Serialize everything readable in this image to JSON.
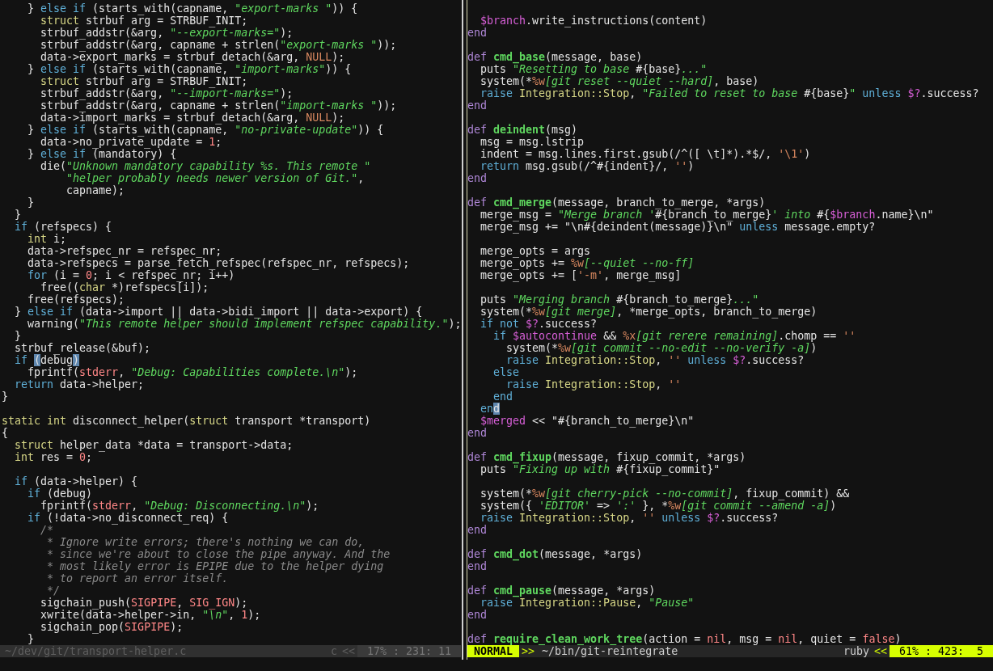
{
  "panes": [
    {
      "lines": [
        {
          "kind": "code",
          "spans": [
            {
              "kind": "n",
              "text": "    } "
            },
            {
              "kind": "k",
              "text": "else if"
            },
            {
              "kind": "n",
              "text": " (starts_with(capname, "
            },
            {
              "kind": "s",
              "text": "\"export-marks \""
            },
            {
              "kind": "n",
              "text": ")) {"
            }
          ]
        },
        {
          "kind": "code",
          "spans": [
            {
              "kind": "t",
              "text": "      struct"
            },
            {
              "kind": "n",
              "text": " strbuf arg = STRBUF_INIT;"
            }
          ]
        },
        {
          "kind": "code",
          "spans": [
            {
              "kind": "n",
              "text": "      strbuf_addstr(&arg, "
            },
            {
              "kind": "s",
              "text": "\"--export-marks=\""
            },
            {
              "kind": "n",
              "text": ");"
            }
          ]
        },
        {
          "kind": "code",
          "spans": [
            {
              "kind": "n",
              "text": "      strbuf_addstr(&arg, capname + strlen("
            },
            {
              "kind": "s",
              "text": "\"export-marks \""
            },
            {
              "kind": "n",
              "text": "));"
            }
          ]
        },
        {
          "kind": "code",
          "spans": [
            {
              "kind": "n",
              "text": "      data->export_marks = strbuf_detach(&arg, "
            },
            {
              "kind": "o",
              "text": "NULL"
            },
            {
              "kind": "n",
              "text": ");"
            }
          ]
        },
        {
          "kind": "code",
          "spans": [
            {
              "kind": "n",
              "text": "    } "
            },
            {
              "kind": "k",
              "text": "else if"
            },
            {
              "kind": "n",
              "text": " (starts_with(capname, "
            },
            {
              "kind": "s",
              "text": "\"import-marks\""
            },
            {
              "kind": "n",
              "text": ")) {"
            }
          ]
        },
        {
          "kind": "code",
          "spans": [
            {
              "kind": "t",
              "text": "      struct"
            },
            {
              "kind": "n",
              "text": " strbuf arg = STRBUF_INIT;"
            }
          ]
        },
        {
          "kind": "code",
          "spans": [
            {
              "kind": "n",
              "text": "      strbuf_addstr(&arg, "
            },
            {
              "kind": "s",
              "text": "\"--import-marks=\""
            },
            {
              "kind": "n",
              "text": ");"
            }
          ]
        },
        {
          "kind": "code",
          "spans": [
            {
              "kind": "n",
              "text": "      strbuf_addstr(&arg, capname + strlen("
            },
            {
              "kind": "s",
              "text": "\"import-marks \""
            },
            {
              "kind": "n",
              "text": "));"
            }
          ]
        },
        {
          "kind": "code",
          "spans": [
            {
              "kind": "n",
              "text": "      data->import_marks = strbuf_detach(&arg, "
            },
            {
              "kind": "o",
              "text": "NULL"
            },
            {
              "kind": "n",
              "text": ");"
            }
          ]
        },
        {
          "kind": "code",
          "spans": [
            {
              "kind": "n",
              "text": "    } "
            },
            {
              "kind": "k",
              "text": "else if"
            },
            {
              "kind": "n",
              "text": " (starts_with(capname, "
            },
            {
              "kind": "s",
              "text": "\"no-private-update\""
            },
            {
              "kind": "n",
              "text": ")) {"
            }
          ]
        },
        {
          "kind": "code",
          "spans": [
            {
              "kind": "n",
              "text": "      data->no_private_update = "
            },
            {
              "kind": "c",
              "text": "1"
            },
            {
              "kind": "n",
              "text": ";"
            }
          ]
        },
        {
          "kind": "code",
          "spans": [
            {
              "kind": "n",
              "text": "    } "
            },
            {
              "kind": "k",
              "text": "else if"
            },
            {
              "kind": "n",
              "text": " (mandatory) {"
            }
          ]
        },
        {
          "kind": "code",
          "spans": [
            {
              "kind": "n",
              "text": "      die("
            },
            {
              "kind": "s",
              "text": "\"Unknown mandatory capability %s. This remote \""
            }
          ]
        },
        {
          "kind": "code",
          "spans": [
            {
              "kind": "s",
              "text": "          \"helper probably needs newer version of Git.\""
            },
            {
              "kind": "n",
              "text": ","
            }
          ]
        },
        {
          "kind": "code",
          "spans": [
            {
              "kind": "n",
              "text": "          capname);"
            }
          ]
        },
        {
          "kind": "code",
          "spans": [
            {
              "kind": "n",
              "text": "    }"
            }
          ]
        },
        {
          "kind": "code",
          "spans": [
            {
              "kind": "n",
              "text": "  }"
            }
          ]
        },
        {
          "kind": "code",
          "spans": [
            {
              "kind": "k",
              "text": "  if"
            },
            {
              "kind": "n",
              "text": " (refspecs) {"
            }
          ]
        },
        {
          "kind": "code",
          "spans": [
            {
              "kind": "t",
              "text": "    int"
            },
            {
              "kind": "n",
              "text": " i;"
            }
          ]
        },
        {
          "kind": "code",
          "spans": [
            {
              "kind": "n",
              "text": "    data->refspec_nr = refspec_nr;"
            }
          ]
        },
        {
          "kind": "code",
          "spans": [
            {
              "kind": "n",
              "text": "    data->refspecs = parse_fetch_refspec(refspec_nr, refspecs);"
            }
          ]
        },
        {
          "kind": "code",
          "spans": [
            {
              "kind": "k",
              "text": "    for"
            },
            {
              "kind": "n",
              "text": " (i = "
            },
            {
              "kind": "c",
              "text": "0"
            },
            {
              "kind": "n",
              "text": "; i < refspec_nr; i++)"
            }
          ]
        },
        {
          "kind": "code",
          "spans": [
            {
              "kind": "n",
              "text": "      free(("
            },
            {
              "kind": "t",
              "text": "char"
            },
            {
              "kind": "n",
              "text": " *)refspecs[i]);"
            }
          ]
        },
        {
          "kind": "code",
          "spans": [
            {
              "kind": "n",
              "text": "    free(refspecs);"
            }
          ]
        },
        {
          "kind": "code",
          "spans": [
            {
              "kind": "n",
              "text": "  } "
            },
            {
              "kind": "k",
              "text": "else if"
            },
            {
              "kind": "n",
              "text": " (data->import || data->bidi_import || data->export) {"
            }
          ]
        },
        {
          "kind": "code",
          "spans": [
            {
              "kind": "n",
              "text": "    warning("
            },
            {
              "kind": "s",
              "text": "\"This remote helper should implement refspec capability.\""
            },
            {
              "kind": "n",
              "text": ");"
            }
          ]
        },
        {
          "kind": "code",
          "spans": [
            {
              "kind": "n",
              "text": "  }"
            }
          ]
        },
        {
          "kind": "code",
          "spans": [
            {
              "kind": "n",
              "text": "  strbuf_release(&buf);"
            }
          ]
        },
        {
          "kind": "code",
          "spans": [
            {
              "kind": "k",
              "text": "  if "
            },
            {
              "kind": "h",
              "text": "("
            },
            {
              "kind": "n",
              "text": "debug"
            },
            {
              "kind": "h",
              "text": ")"
            }
          ]
        },
        {
          "kind": "code",
          "spans": [
            {
              "kind": "n",
              "text": "    fprintf("
            },
            {
              "kind": "c",
              "text": "stderr"
            },
            {
              "kind": "n",
              "text": ", "
            },
            {
              "kind": "s",
              "text": "\"Debug: Capabilities complete.\\n\""
            },
            {
              "kind": "n",
              "text": ");"
            }
          ]
        },
        {
          "kind": "code",
          "spans": [
            {
              "kind": "k",
              "text": "  return"
            },
            {
              "kind": "n",
              "text": " data->helper;"
            }
          ]
        },
        {
          "kind": "code",
          "spans": [
            {
              "kind": "n",
              "text": "}"
            }
          ]
        },
        {
          "kind": "blank"
        },
        {
          "kind": "code",
          "spans": [
            {
              "kind": "t",
              "text": "static int"
            },
            {
              "kind": "n",
              "text": " disconnect_helper("
            },
            {
              "kind": "t",
              "text": "struct"
            },
            {
              "kind": "n",
              "text": " transport *transport)"
            }
          ]
        },
        {
          "kind": "code",
          "spans": [
            {
              "kind": "n",
              "text": "{"
            }
          ]
        },
        {
          "kind": "code",
          "spans": [
            {
              "kind": "t",
              "text": "  struct"
            },
            {
              "kind": "n",
              "text": " helper_data *data = transport->data;"
            }
          ]
        },
        {
          "kind": "code",
          "spans": [
            {
              "kind": "t",
              "text": "  int"
            },
            {
              "kind": "n",
              "text": " res = "
            },
            {
              "kind": "c",
              "text": "0"
            },
            {
              "kind": "n",
              "text": ";"
            }
          ]
        },
        {
          "kind": "blank"
        },
        {
          "kind": "code",
          "spans": [
            {
              "kind": "k",
              "text": "  if"
            },
            {
              "kind": "n",
              "text": " (data->helper) {"
            }
          ]
        },
        {
          "kind": "code",
          "spans": [
            {
              "kind": "k",
              "text": "    if"
            },
            {
              "kind": "n",
              "text": " (debug)"
            }
          ]
        },
        {
          "kind": "code",
          "spans": [
            {
              "kind": "n",
              "text": "      fprintf("
            },
            {
              "kind": "c",
              "text": "stderr"
            },
            {
              "kind": "n",
              "text": ", "
            },
            {
              "kind": "s",
              "text": "\"Debug: Disconnecting.\\n\""
            },
            {
              "kind": "n",
              "text": ");"
            }
          ]
        },
        {
          "kind": "code",
          "spans": [
            {
              "kind": "k",
              "text": "    if"
            },
            {
              "kind": "n",
              "text": " (!data->no_disconnect_req) {"
            }
          ]
        },
        {
          "kind": "code",
          "spans": [
            {
              "kind": "m",
              "text": "      /*"
            }
          ]
        },
        {
          "kind": "code",
          "spans": [
            {
              "kind": "m",
              "text": "       * Ignore write errors; there's nothing we can do,"
            }
          ]
        },
        {
          "kind": "code",
          "spans": [
            {
              "kind": "m",
              "text": "       * since we're about to close the pipe anyway. And the"
            }
          ]
        },
        {
          "kind": "code",
          "spans": [
            {
              "kind": "m",
              "text": "       * most likely error is EPIPE due to the helper dying"
            }
          ]
        },
        {
          "kind": "code",
          "spans": [
            {
              "kind": "m",
              "text": "       * to report an error itself."
            }
          ]
        },
        {
          "kind": "code",
          "spans": [
            {
              "kind": "m",
              "text": "       */"
            }
          ]
        },
        {
          "kind": "code",
          "spans": [
            {
              "kind": "n",
              "text": "      sigchain_push("
            },
            {
              "kind": "c",
              "text": "SIGPIPE"
            },
            {
              "kind": "n",
              "text": ", "
            },
            {
              "kind": "c",
              "text": "SIG_IGN"
            },
            {
              "kind": "n",
              "text": ");"
            }
          ]
        },
        {
          "kind": "code",
          "spans": [
            {
              "kind": "n",
              "text": "      xwrite(data->helper->in, "
            },
            {
              "kind": "s",
              "text": "\"\\n\""
            },
            {
              "kind": "n",
              "text": ", "
            },
            {
              "kind": "c",
              "text": "1"
            },
            {
              "kind": "n",
              "text": ");"
            }
          ]
        },
        {
          "kind": "code",
          "spans": [
            {
              "kind": "n",
              "text": "      sigchain_pop("
            },
            {
              "kind": "c",
              "text": "SIGPIPE"
            },
            {
              "kind": "n",
              "text": ");"
            }
          ]
        },
        {
          "kind": "code",
          "spans": [
            {
              "kind": "n",
              "text": "    }"
            }
          ]
        }
      ],
      "status": {
        "active": false,
        "path": "~/dev/git/transport-helper.c",
        "filetype": "c",
        "arrow": "<<",
        "position": "17% : 231: 11"
      }
    },
    {
      "lines": [
        {
          "kind": "blank"
        },
        {
          "kind": "code",
          "spans": [
            {
              "kind": "g",
              "text": "  $branch"
            },
            {
              "kind": "n",
              "text": ".write_instructions(content)"
            }
          ]
        },
        {
          "kind": "code",
          "spans": [
            {
              "kind": "d",
              "text": "end"
            }
          ]
        },
        {
          "kind": "blank"
        },
        {
          "kind": "code",
          "spans": [
            {
              "kind": "d",
              "text": "def "
            },
            {
              "kind": "f",
              "text": "cmd_base"
            },
            {
              "kind": "n",
              "text": "(message, base)"
            }
          ]
        },
        {
          "kind": "code",
          "spans": [
            {
              "kind": "n",
              "text": "  puts "
            },
            {
              "kind": "s",
              "text": "\"Resetting to base "
            },
            {
              "kind": "n",
              "text": "#{base}"
            },
            {
              "kind": "s",
              "text": "...\""
            }
          ]
        },
        {
          "kind": "code",
          "spans": [
            {
              "kind": "n",
              "text": "  system(*"
            },
            {
              "kind": "o",
              "text": "%w"
            },
            {
              "kind": "s",
              "text": "[git reset --quiet --hard]"
            },
            {
              "kind": "n",
              "text": ", base)"
            }
          ]
        },
        {
          "kind": "code",
          "spans": [
            {
              "kind": "k",
              "text": "  raise "
            },
            {
              "kind": "t",
              "text": "Integration::Stop"
            },
            {
              "kind": "n",
              "text": ", "
            },
            {
              "kind": "s",
              "text": "\"Failed to reset to base "
            },
            {
              "kind": "n",
              "text": "#{base}"
            },
            {
              "kind": "s",
              "text": "\" "
            },
            {
              "kind": "k",
              "text": "unless "
            },
            {
              "kind": "g",
              "text": "$?"
            },
            {
              "kind": "n",
              "text": ".success?"
            }
          ]
        },
        {
          "kind": "code",
          "spans": [
            {
              "kind": "d",
              "text": "end"
            }
          ]
        },
        {
          "kind": "blank"
        },
        {
          "kind": "code",
          "spans": [
            {
              "kind": "d",
              "text": "def "
            },
            {
              "kind": "f",
              "text": "deindent"
            },
            {
              "kind": "n",
              "text": "(msg)"
            }
          ]
        },
        {
          "kind": "code",
          "spans": [
            {
              "kind": "n",
              "text": "  msg = msg.lstrip"
            }
          ]
        },
        {
          "kind": "code",
          "spans": [
            {
              "kind": "n",
              "text": "  indent = msg.lines.first.gsub(/^([ \\t]*).*$/, "
            },
            {
              "kind": "o",
              "text": "'\\1'"
            },
            {
              "kind": "n",
              "text": ")"
            }
          ]
        },
        {
          "kind": "code",
          "spans": [
            {
              "kind": "k",
              "text": "  return"
            },
            {
              "kind": "n",
              "text": " msg.gsub(/^#{indent}/, "
            },
            {
              "kind": "o",
              "text": "''"
            },
            {
              "kind": "n",
              "text": ")"
            }
          ]
        },
        {
          "kind": "code",
          "spans": [
            {
              "kind": "d",
              "text": "end"
            }
          ]
        },
        {
          "kind": "blank"
        },
        {
          "kind": "code",
          "spans": [
            {
              "kind": "d",
              "text": "def "
            },
            {
              "kind": "f",
              "text": "cmd_merge"
            },
            {
              "kind": "n",
              "text": "(message, branch_to_merge, *args)"
            }
          ]
        },
        {
          "kind": "code",
          "spans": [
            {
              "kind": "n",
              "text": "  merge_msg = "
            },
            {
              "kind": "s",
              "text": "\"Merge branch '"
            },
            {
              "kind": "n",
              "text": "#{branch_to_merge}"
            },
            {
              "kind": "s",
              "text": "' into "
            },
            {
              "kind": "n",
              "text": "#{"
            },
            {
              "kind": "g",
              "text": "$branch"
            },
            {
              "kind": "n",
              "text": ".name}\\n\""
            }
          ]
        },
        {
          "kind": "code",
          "spans": [
            {
              "kind": "n",
              "text": "  merge_msg += \"\\n#{deindent(message)}\\n\" "
            },
            {
              "kind": "k",
              "text": "unless"
            },
            {
              "kind": "n",
              "text": " message.empty?"
            }
          ]
        },
        {
          "kind": "blank"
        },
        {
          "kind": "code",
          "spans": [
            {
              "kind": "n",
              "text": "  merge_opts = args"
            }
          ]
        },
        {
          "kind": "code",
          "spans": [
            {
              "kind": "n",
              "text": "  merge_opts += "
            },
            {
              "kind": "o",
              "text": "%w"
            },
            {
              "kind": "s",
              "text": "[--quiet --no-ff]"
            }
          ]
        },
        {
          "kind": "code",
          "spans": [
            {
              "kind": "n",
              "text": "  merge_opts += ["
            },
            {
              "kind": "o",
              "text": "'-m'"
            },
            {
              "kind": "n",
              "text": ", merge_msg]"
            }
          ]
        },
        {
          "kind": "blank"
        },
        {
          "kind": "code",
          "spans": [
            {
              "kind": "n",
              "text": "  puts "
            },
            {
              "kind": "s",
              "text": "\"Merging branch "
            },
            {
              "kind": "n",
              "text": "#{branch_to_merge}"
            },
            {
              "kind": "s",
              "text": "...\""
            }
          ]
        },
        {
          "kind": "code",
          "spans": [
            {
              "kind": "n",
              "text": "  system(*"
            },
            {
              "kind": "o",
              "text": "%w"
            },
            {
              "kind": "s",
              "text": "[git merge]"
            },
            {
              "kind": "n",
              "text": ", *merge_opts, branch_to_merge)"
            }
          ]
        },
        {
          "kind": "code",
          "spans": [
            {
              "kind": "k",
              "text": "  if not "
            },
            {
              "kind": "g",
              "text": "$?"
            },
            {
              "kind": "n",
              "text": ".success?"
            }
          ]
        },
        {
          "kind": "code",
          "spans": [
            {
              "kind": "k",
              "text": "    if "
            },
            {
              "kind": "g",
              "text": "$autocontinue"
            },
            {
              "kind": "n",
              "text": " && "
            },
            {
              "kind": "o",
              "text": "%x"
            },
            {
              "kind": "s",
              "text": "[git rerere remaining]"
            },
            {
              "kind": "n",
              "text": ".chomp == "
            },
            {
              "kind": "o",
              "text": "''"
            }
          ]
        },
        {
          "kind": "code",
          "spans": [
            {
              "kind": "n",
              "text": "      system(*"
            },
            {
              "kind": "o",
              "text": "%w"
            },
            {
              "kind": "s",
              "text": "[git commit --no-edit --no-verify -a]"
            },
            {
              "kind": "n",
              "text": ")"
            }
          ]
        },
        {
          "kind": "code",
          "spans": [
            {
              "kind": "k",
              "text": "      raise "
            },
            {
              "kind": "t",
              "text": "Integration::Stop"
            },
            {
              "kind": "n",
              "text": ", "
            },
            {
              "kind": "o",
              "text": "'' "
            },
            {
              "kind": "k",
              "text": "unless "
            },
            {
              "kind": "g",
              "text": "$?"
            },
            {
              "kind": "n",
              "text": ".success?"
            }
          ]
        },
        {
          "kind": "code",
          "spans": [
            {
              "kind": "k",
              "text": "    else"
            }
          ]
        },
        {
          "kind": "code",
          "spans": [
            {
              "kind": "k",
              "text": "      raise "
            },
            {
              "kind": "t",
              "text": "Integration::Stop"
            },
            {
              "kind": "n",
              "text": ", "
            },
            {
              "kind": "o",
              "text": "''"
            }
          ]
        },
        {
          "kind": "code",
          "spans": [
            {
              "kind": "k",
              "text": "    end"
            }
          ]
        },
        {
          "kind": "code",
          "spans": [
            {
              "kind": "k",
              "text": "  en"
            },
            {
              "kind": "h",
              "text": "d"
            }
          ]
        },
        {
          "kind": "code",
          "spans": [
            {
              "kind": "g",
              "text": "  $merged"
            },
            {
              "kind": "n",
              "text": " << \"#{branch_to_merge}\\n\""
            }
          ]
        },
        {
          "kind": "code",
          "spans": [
            {
              "kind": "d",
              "text": "end"
            }
          ]
        },
        {
          "kind": "blank"
        },
        {
          "kind": "code",
          "spans": [
            {
              "kind": "d",
              "text": "def "
            },
            {
              "kind": "f",
              "text": "cmd_fixup"
            },
            {
              "kind": "n",
              "text": "(message, fixup_commit, *args)"
            }
          ]
        },
        {
          "kind": "code",
          "spans": [
            {
              "kind": "n",
              "text": "  puts "
            },
            {
              "kind": "s",
              "text": "\"Fixing up with "
            },
            {
              "kind": "n",
              "text": "#{fixup_commit}\""
            }
          ]
        },
        {
          "kind": "blank"
        },
        {
          "kind": "code",
          "spans": [
            {
              "kind": "n",
              "text": "  system(*"
            },
            {
              "kind": "o",
              "text": "%w"
            },
            {
              "kind": "s",
              "text": "[git cherry-pick --no-commit]"
            },
            {
              "kind": "n",
              "text": ", fixup_commit) &&"
            }
          ]
        },
        {
          "kind": "code",
          "spans": [
            {
              "kind": "n",
              "text": "  system({ "
            },
            {
              "kind": "s",
              "text": "'EDITOR'"
            },
            {
              "kind": "n",
              "text": " => "
            },
            {
              "kind": "s",
              "text": "':'"
            },
            {
              "kind": "n",
              "text": " }, *"
            },
            {
              "kind": "o",
              "text": "%w"
            },
            {
              "kind": "s",
              "text": "[git commit --amend -a]"
            },
            {
              "kind": "n",
              "text": ")"
            }
          ]
        },
        {
          "kind": "code",
          "spans": [
            {
              "kind": "k",
              "text": "  raise "
            },
            {
              "kind": "t",
              "text": "Integration::Stop"
            },
            {
              "kind": "n",
              "text": ", "
            },
            {
              "kind": "o",
              "text": "'' "
            },
            {
              "kind": "k",
              "text": "unless "
            },
            {
              "kind": "g",
              "text": "$?"
            },
            {
              "kind": "n",
              "text": ".success?"
            }
          ]
        },
        {
          "kind": "code",
          "spans": [
            {
              "kind": "d",
              "text": "end"
            }
          ]
        },
        {
          "kind": "blank"
        },
        {
          "kind": "code",
          "spans": [
            {
              "kind": "d",
              "text": "def "
            },
            {
              "kind": "f",
              "text": "cmd_dot"
            },
            {
              "kind": "n",
              "text": "(message, *args)"
            }
          ]
        },
        {
          "kind": "code",
          "spans": [
            {
              "kind": "d",
              "text": "end"
            }
          ]
        },
        {
          "kind": "blank"
        },
        {
          "kind": "code",
          "spans": [
            {
              "kind": "d",
              "text": "def "
            },
            {
              "kind": "f",
              "text": "cmd_pause"
            },
            {
              "kind": "n",
              "text": "(message, *args)"
            }
          ]
        },
        {
          "kind": "code",
          "spans": [
            {
              "kind": "k",
              "text": "  raise "
            },
            {
              "kind": "t",
              "text": "Integration::Pause"
            },
            {
              "kind": "n",
              "text": ", "
            },
            {
              "kind": "s",
              "text": "\"Pause\""
            }
          ]
        },
        {
          "kind": "code",
          "spans": [
            {
              "kind": "d",
              "text": "end"
            }
          ]
        },
        {
          "kind": "blank"
        },
        {
          "kind": "code",
          "spans": [
            {
              "kind": "d",
              "text": "def "
            },
            {
              "kind": "f",
              "text": "require_clean_work_tree"
            },
            {
              "kind": "n",
              "text": "(action = "
            },
            {
              "kind": "c",
              "text": "nil"
            },
            {
              "kind": "n",
              "text": ", msg = "
            },
            {
              "kind": "c",
              "text": "nil"
            },
            {
              "kind": "n",
              "text": ", quiet = "
            },
            {
              "kind": "c",
              "text": "false"
            },
            {
              "kind": "n",
              "text": ")"
            }
          ]
        }
      ],
      "status": {
        "active": true,
        "mode": "NORMAL",
        "mode_arrow": ">>",
        "path": "~/bin/git-reintegrate",
        "filetype": "ruby",
        "arrow": "<<",
        "position": "61% : 423:  5"
      }
    }
  ]
}
